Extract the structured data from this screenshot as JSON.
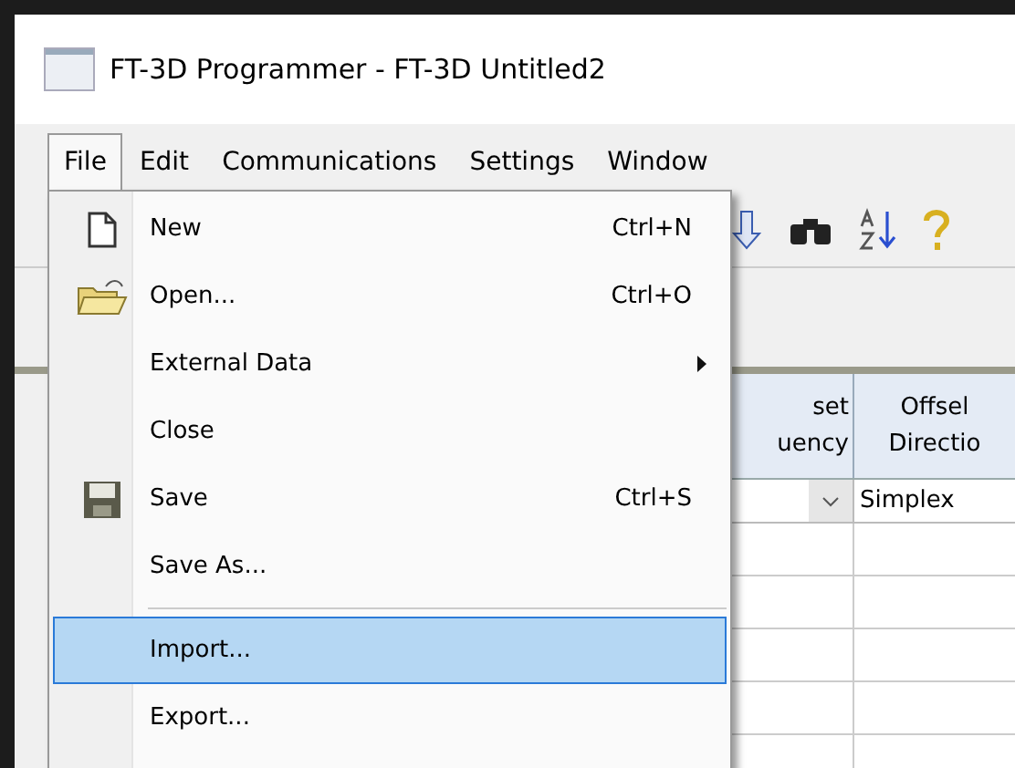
{
  "window": {
    "title": "FT-3D Programmer - FT-3D Untitled2"
  },
  "menu_bar": [
    {
      "label": "File",
      "selected": true
    },
    {
      "label": "Edit",
      "selected": false
    },
    {
      "label": "Communications",
      "selected": false
    },
    {
      "label": "Settings",
      "selected": false
    },
    {
      "label": "Window",
      "selected": false
    }
  ],
  "file_menu": [
    {
      "kind": "item",
      "label": "New",
      "shortcut": "Ctrl+N",
      "submenu": false,
      "selected": false
    },
    {
      "kind": "item",
      "label": "Open...",
      "shortcut": "Ctrl+O",
      "submenu": false,
      "selected": false
    },
    {
      "kind": "item",
      "label": "External Data",
      "submenu": true,
      "selected": false
    },
    {
      "kind": "item",
      "label": "Close",
      "submenu": false,
      "selected": false
    },
    {
      "kind": "item",
      "label": "Save",
      "shortcut": "Ctrl+S",
      "submenu": false,
      "selected": false
    },
    {
      "kind": "item",
      "label": "Save As...",
      "submenu": false,
      "selected": false
    },
    {
      "kind": "separator"
    },
    {
      "kind": "item",
      "label": "Import...",
      "submenu": false,
      "selected": true
    },
    {
      "kind": "item",
      "label": "Export...",
      "submenu": false,
      "selected": false
    }
  ],
  "table": {
    "columns": [
      {
        "lines": [
          "set",
          "uency"
        ]
      },
      {
        "lines": [
          "Offsel",
          "Directio"
        ]
      }
    ],
    "rows": [
      {
        "cells": [
          {
            "kind": "dropdown"
          },
          {
            "kind": "text",
            "value": "Simplex"
          }
        ]
      }
    ]
  }
}
